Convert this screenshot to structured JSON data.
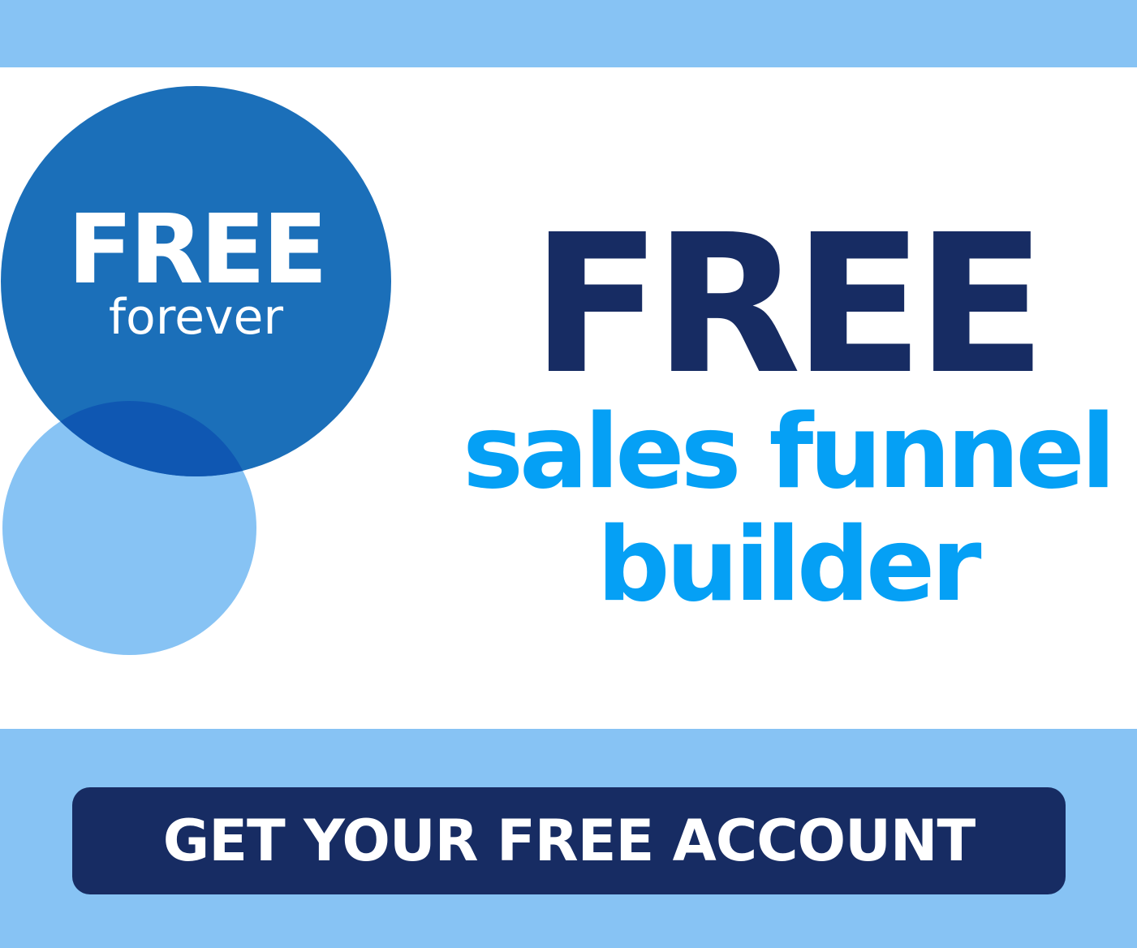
{
  "badge": {
    "title": "FREE",
    "subtitle": "forever"
  },
  "headline": {
    "title": "FREE",
    "subtitle_line1": "sales funnel",
    "subtitle_line2": "builder"
  },
  "cta": {
    "label": "GET YOUR FREE ACCOUNT"
  },
  "colors": {
    "band": "#87c3f4",
    "badge_circle": "#1b6fb9",
    "overlap": "#0f57b2",
    "navy": "#172c63",
    "bright_blue": "#05a0f5",
    "white": "#ffffff"
  }
}
